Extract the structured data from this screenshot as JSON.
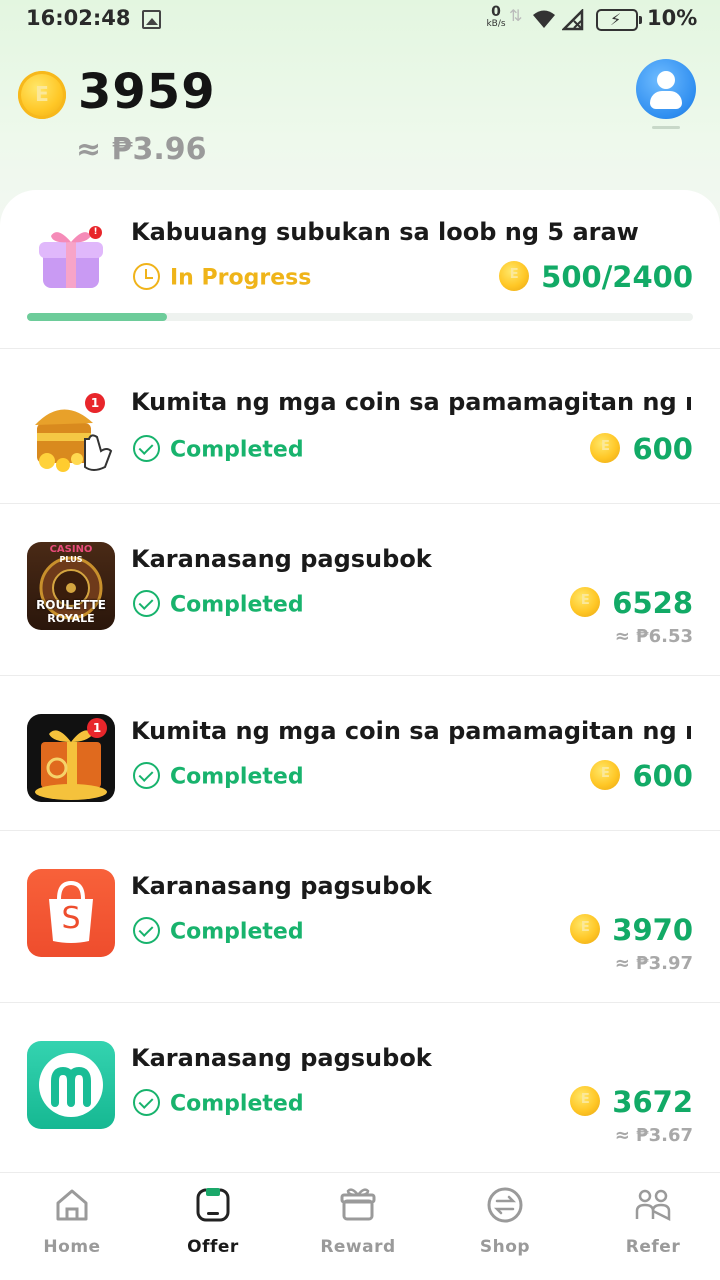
{
  "status_bar": {
    "time": "16:02:48",
    "net_speed": "0",
    "net_unit": "kB/s",
    "battery": "10%"
  },
  "header": {
    "coin_letter": "E",
    "balance": "3959",
    "balance_peso": "≈ ₱3.96"
  },
  "tasks": [
    {
      "title": "Kabuuang subukan sa loob ng 5 araw",
      "status": "In Progress",
      "reward": "500/2400",
      "progress": 0.21,
      "icon": "gift-box-icon",
      "badge": ""
    },
    {
      "title": "Kumita ng mga coin sa pamamagitan ng ra...",
      "status": "Completed",
      "reward": "600",
      "icon": "treasure-chest-icon",
      "badge": "1"
    },
    {
      "title": "Karanasang pagsubok",
      "status": "Completed",
      "reward": "6528",
      "peso": "≈ ₱6.53",
      "icon": "roulette-royale-app-icon",
      "app_top": "CASINO",
      "app_sub": "PLUS",
      "app_main": "ROULETTE",
      "app_main2": "ROYALE"
    },
    {
      "title": "Kumita ng mga coin sa pamamagitan ng ra...",
      "status": "Completed",
      "reward": "600",
      "icon": "gift-coins-app-icon",
      "badge": "1"
    },
    {
      "title": "Karanasang pagsubok",
      "status": "Completed",
      "reward": "3970",
      "peso": "≈ ₱3.97",
      "icon": "shopee-app-icon",
      "app_letter": "S"
    },
    {
      "title": "Karanasang pagsubok",
      "status": "Completed",
      "reward": "3672",
      "peso": "≈ ₱3.67",
      "icon": "m-app-icon"
    }
  ],
  "nav": [
    {
      "label": "Home",
      "icon": "home-icon",
      "active": false
    },
    {
      "label": "Offer",
      "icon": "offer-icon",
      "active": true
    },
    {
      "label": "Reward",
      "icon": "gift-icon",
      "active": false
    },
    {
      "label": "Shop",
      "icon": "exchange-icon",
      "active": false
    },
    {
      "label": "Refer",
      "icon": "people-icon",
      "active": false
    }
  ],
  "colors": {
    "green": "#12aa66",
    "completed": "#18b36d",
    "in_progress": "#efb419",
    "progress_fill": "#6dcc9a"
  }
}
